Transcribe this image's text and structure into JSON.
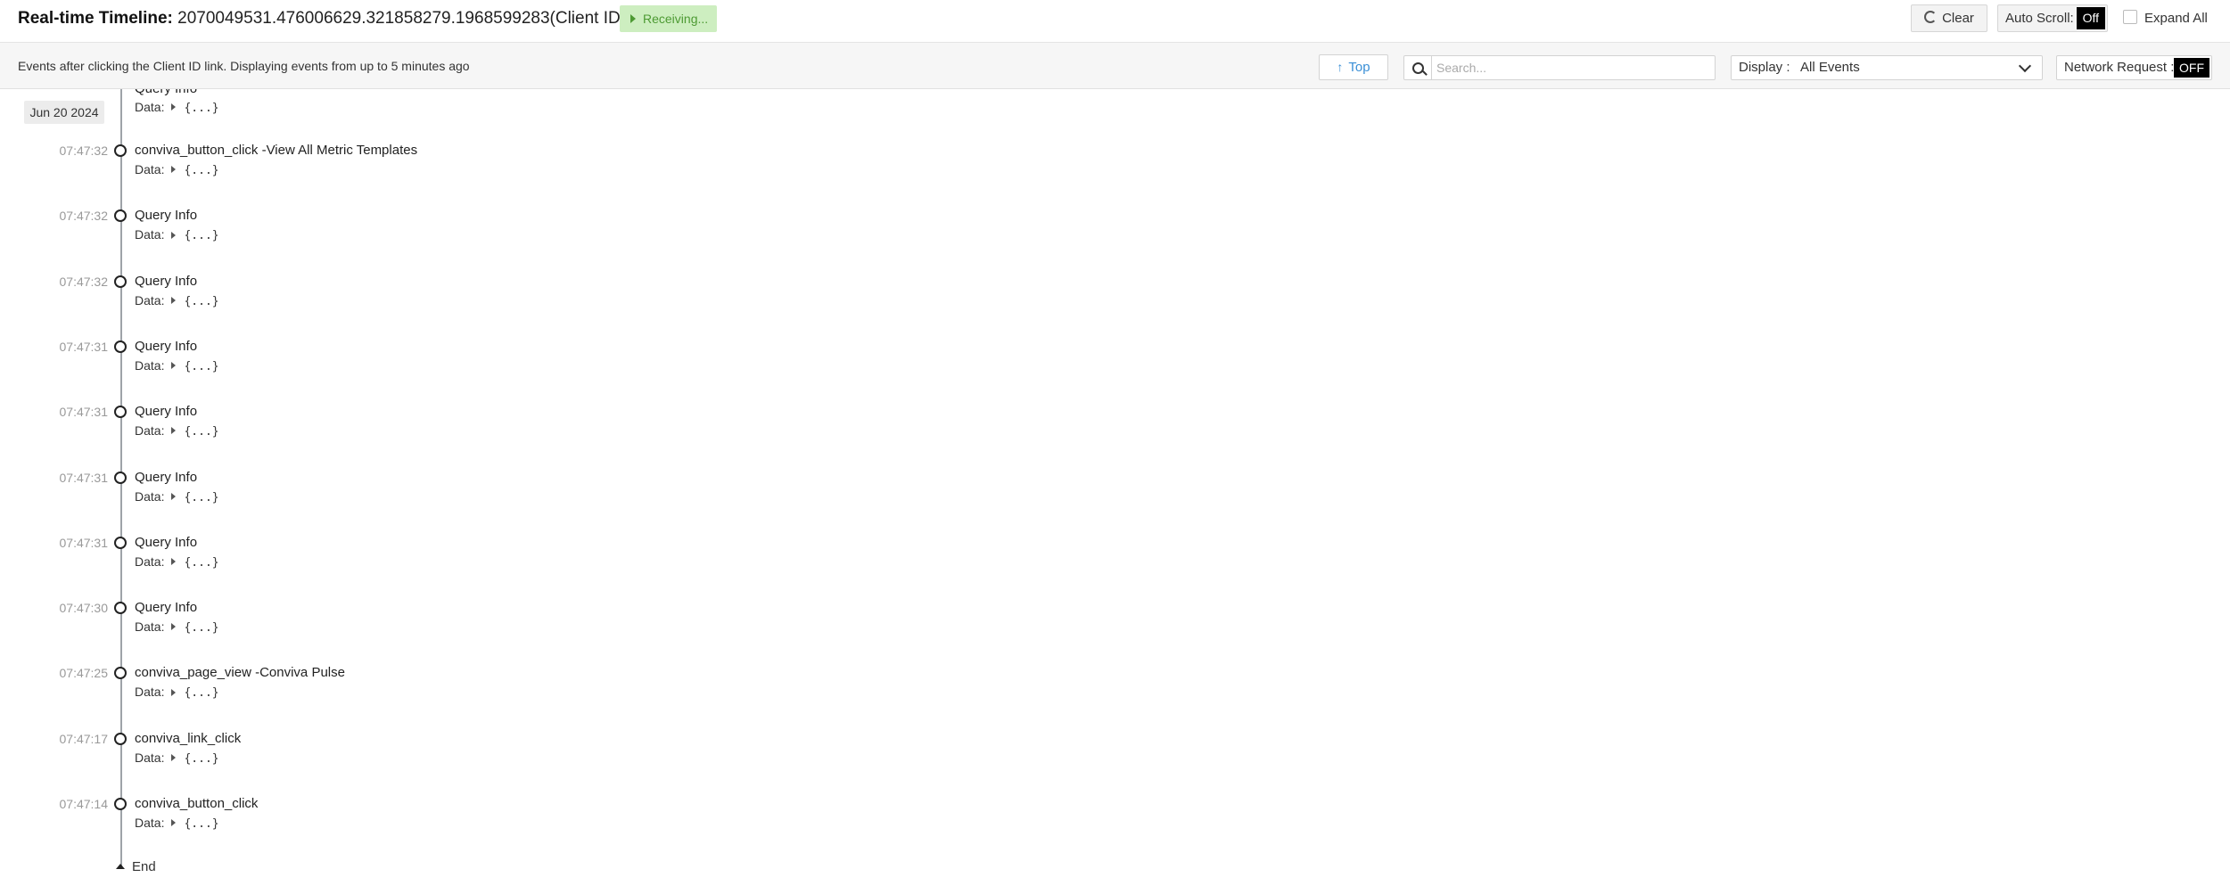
{
  "header": {
    "title_label": "Real-time Timeline:",
    "client_id": "2070049531.476006629.321858279.1968599283(Client ID)",
    "status": "Receiving...",
    "clear_label": "Clear",
    "auto_scroll_label": "Auto Scroll:",
    "auto_scroll_value": "Off",
    "expand_all_label": "Expand All"
  },
  "subbar": {
    "description": "Events after clicking the Client ID link. Displaying events from up to 5 minutes ago",
    "top_label": "Top",
    "search_placeholder": "Search...",
    "display_label": "Display :",
    "display_value": "All Events",
    "network_request_label": "Network Request :",
    "network_request_value": "OFF"
  },
  "timeline": {
    "date": "Jun 20 2024",
    "data_label": "Data:",
    "data_collapsed": "{...}",
    "events": [
      {
        "time": "07:47:32",
        "name": "conviva_button_click -View All Metric Templates"
      },
      {
        "time": "07:47:32",
        "name": "Query Info"
      },
      {
        "time": "07:47:32",
        "name": "Query Info"
      },
      {
        "time": "07:47:31",
        "name": "Query Info"
      },
      {
        "time": "07:47:31",
        "name": "Query Info"
      },
      {
        "time": "07:47:31",
        "name": "Query Info"
      },
      {
        "time": "07:47:31",
        "name": "Query Info"
      },
      {
        "time": "07:47:30",
        "name": "Query Info"
      },
      {
        "time": "07:47:25",
        "name": "conviva_page_view -Conviva Pulse"
      },
      {
        "time": "07:47:17",
        "name": "conviva_link_click"
      },
      {
        "time": "07:47:14",
        "name": "conviva_button_click"
      }
    ],
    "end_label": "End"
  }
}
